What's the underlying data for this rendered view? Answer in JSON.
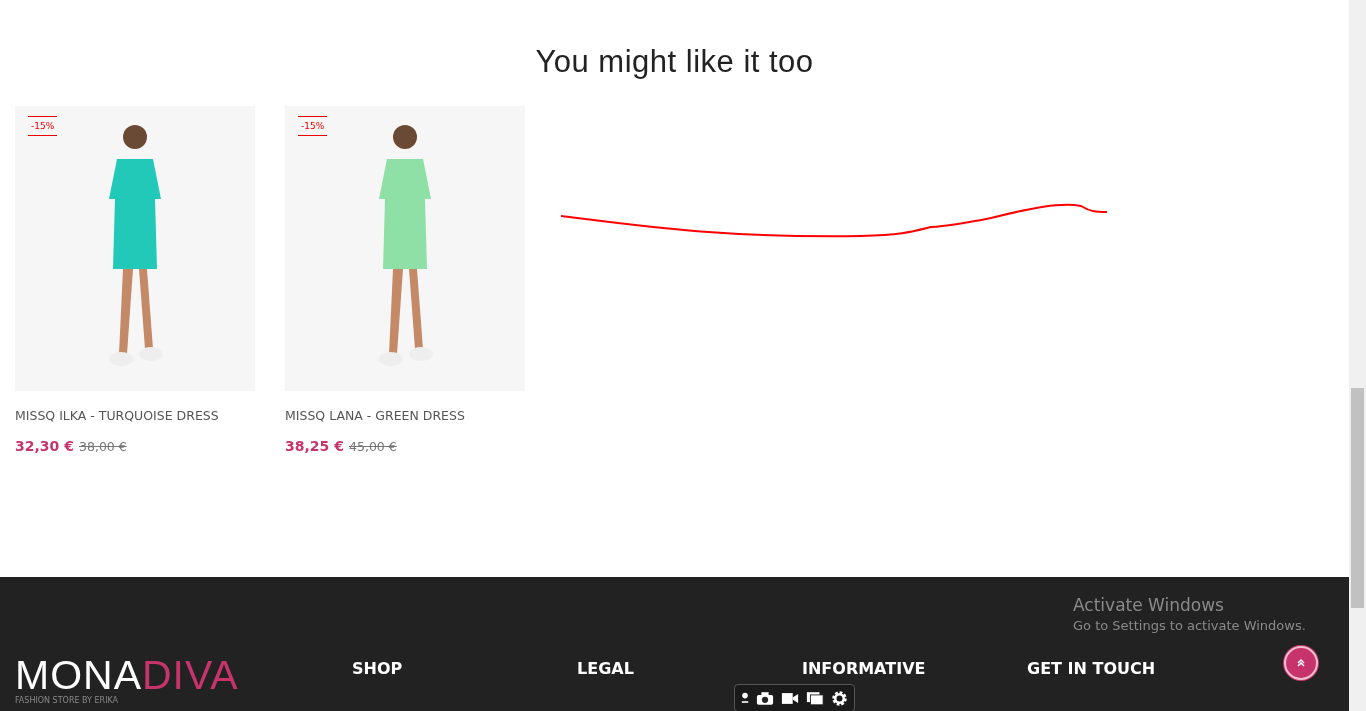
{
  "section_title": "You might like it too",
  "products": [
    {
      "badge": "-15%",
      "name": "MISSQ ILKA - TURQUOISE DRESS",
      "price": "32,30 €",
      "old_price": "38,00 €",
      "color": "#22c9b8"
    },
    {
      "badge": "-15%",
      "name": "MISSQ LANA - GREEN DRESS",
      "price": "38,25 €",
      "old_price": "45,00 €",
      "color": "#8fe0a6"
    }
  ],
  "footer": {
    "logo": {
      "first": "MONA",
      "second": "DIVA",
      "tagline": "FASHION STORE BY ERIKA"
    },
    "headings": [
      "SHOP",
      "LEGAL",
      "INFORMATIVE",
      "GET IN TOUCH"
    ]
  },
  "os_notice": {
    "title": "Activate Windows",
    "text": "Go to Settings to activate Windows."
  }
}
